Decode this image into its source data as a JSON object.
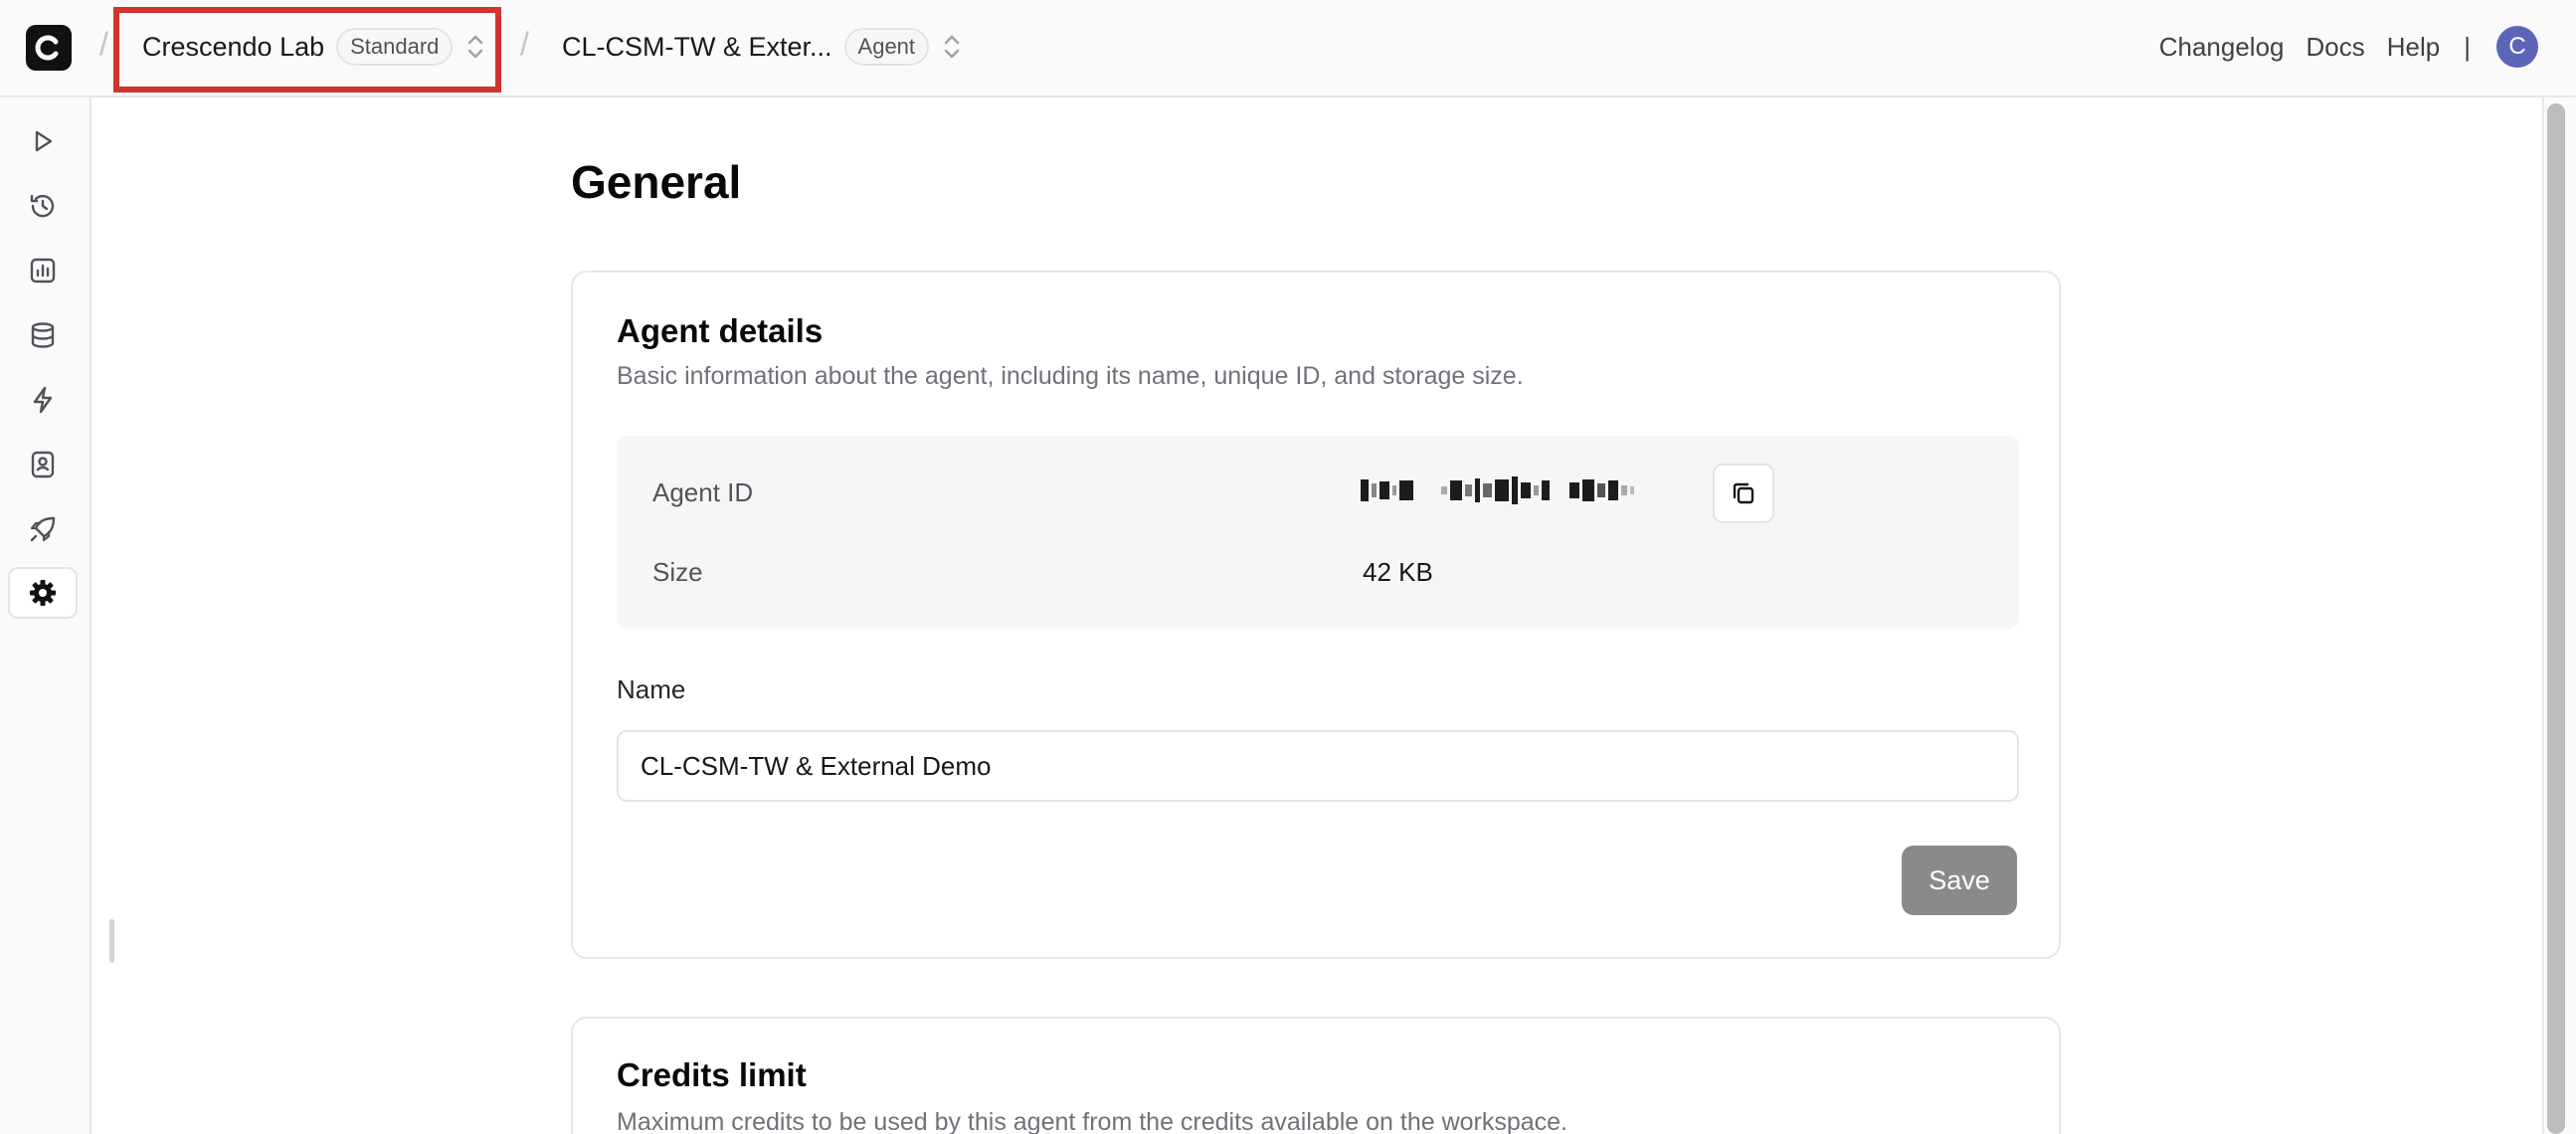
{
  "header": {
    "workspace": {
      "name": "Crescendo Lab",
      "plan": "Standard"
    },
    "agent": {
      "name": "CL-CSM-TW & Exter...",
      "badge": "Agent"
    },
    "links": {
      "changelog": "Changelog",
      "docs": "Docs",
      "help": "Help",
      "separator": "|"
    },
    "avatar_initial": "C"
  },
  "sidebar": {
    "items": [
      {
        "icon": "play-icon"
      },
      {
        "icon": "history-icon"
      },
      {
        "icon": "analytics-icon"
      },
      {
        "icon": "database-icon"
      },
      {
        "icon": "integrations-icon"
      },
      {
        "icon": "contacts-icon"
      },
      {
        "icon": "deploy-icon"
      },
      {
        "icon": "settings-icon",
        "active": true
      }
    ]
  },
  "page": {
    "title": "General"
  },
  "agent_details": {
    "heading": "Agent details",
    "description": "Basic information about the agent, including its name, unique ID, and storage size.",
    "id_label": "Agent ID",
    "size_label": "Size",
    "size_value": "42 KB",
    "name_label": "Name",
    "name_value": "CL-CSM-TW & External Demo",
    "save_label": "Save"
  },
  "credits_limit": {
    "heading": "Credits limit",
    "description": "Maximum credits to be used by this agent from the credits available on the workspace."
  },
  "colors": {
    "highlight": "#d0342c",
    "avatar": "#5c65b8",
    "save_button": "#8a8a8a"
  }
}
